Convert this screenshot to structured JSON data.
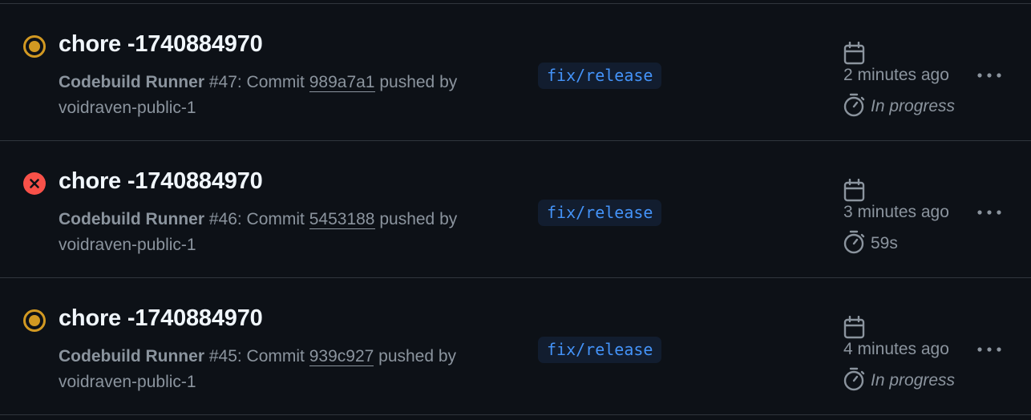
{
  "runs": [
    {
      "status": "in-progress",
      "title": "chore -1740884970",
      "workflow": "Codebuild Runner",
      "run_number": "#47",
      "commit_prefix": ": Commit ",
      "commit_sha": "989a7a1",
      "pushed_by": " pushed by voidraven-public-1",
      "branch": "fix/release",
      "time_ago": "2 minutes ago",
      "duration": "In progress"
    },
    {
      "status": "failure",
      "title": "chore -1740884970",
      "workflow": "Codebuild Runner",
      "run_number": "#46",
      "commit_prefix": ": Commit ",
      "commit_sha": "5453188",
      "pushed_by": " pushed by voidraven-public-1",
      "branch": "fix/release",
      "time_ago": "3 minutes ago",
      "duration": "59s"
    },
    {
      "status": "in-progress",
      "title": "chore -1740884970",
      "workflow": "Codebuild Runner",
      "run_number": "#45",
      "commit_prefix": ": Commit ",
      "commit_sha": "939c927",
      "pushed_by": " pushed by voidraven-public-1",
      "branch": "fix/release",
      "time_ago": "4 minutes ago",
      "duration": "In progress"
    }
  ],
  "colors": {
    "background": "#0d1117",
    "in_progress": "#d29922",
    "failure": "#f85149",
    "branch_text": "#4493f8",
    "muted_text": "#8b949e",
    "title_text": "#f0f6fc"
  },
  "icons": {
    "in_progress": "in-progress-dot-icon",
    "failure": "x-circle-icon",
    "calendar": "calendar-icon",
    "timer": "stopwatch-icon",
    "more": "kebab-horizontal-icon"
  }
}
